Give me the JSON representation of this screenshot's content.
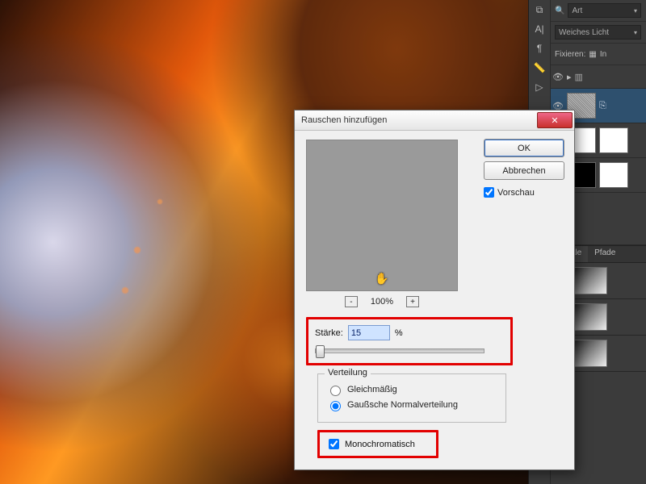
{
  "right_panel": {
    "opacity_label": "Art",
    "blend_mode": "Weiches Licht",
    "lock_label": "Fixieren:",
    "lock_extra": "In",
    "tabs": {
      "channels": "Kanäle",
      "paths": "Pfade"
    }
  },
  "dialog": {
    "title": "Rauschen hinzufügen",
    "ok": "OK",
    "cancel": "Abbrechen",
    "preview": "Vorschau",
    "zoom": "100%",
    "amount_label": "Stärke:",
    "amount_value": "15",
    "amount_unit": "%",
    "distribution": {
      "legend": "Verteilung",
      "uniform": "Gleichmäßig",
      "gaussian": "Gaußsche Normalverteilung",
      "selected": "gaussian"
    },
    "mono": "Monochromatisch",
    "mono_checked": true,
    "preview_checked": true
  }
}
